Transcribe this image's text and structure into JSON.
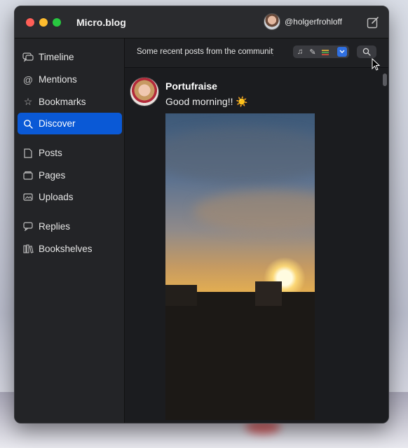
{
  "app": {
    "title": "Micro.blog"
  },
  "account": {
    "username": "@holgerfrohloff"
  },
  "sidebar": {
    "items": [
      {
        "label": "Timeline",
        "icon": "speech-bubbles-icon",
        "active": false
      },
      {
        "label": "Mentions",
        "icon": "at-sign-icon",
        "active": false
      },
      {
        "label": "Bookmarks",
        "icon": "star-icon",
        "active": false
      },
      {
        "label": "Discover",
        "icon": "search-icon",
        "active": true
      },
      {
        "label": "Posts",
        "icon": "document-icon",
        "active": false
      },
      {
        "label": "Pages",
        "icon": "folder-icon",
        "active": false
      },
      {
        "label": "Uploads",
        "icon": "photo-icon",
        "active": false
      },
      {
        "label": "Replies",
        "icon": "speech-bubble-icon",
        "active": false
      },
      {
        "label": "Bookshelves",
        "icon": "books-icon",
        "active": false
      }
    ]
  },
  "toolbar": {
    "description": "Some recent posts from the community",
    "segment_icons": [
      "music-note-icon",
      "pencil-icon",
      "books-icon"
    ],
    "accent": "#0a59d6"
  },
  "post": {
    "author": "Portufraise",
    "text": "Good morning!! ☀️"
  },
  "colors": {
    "accent": "#0a59d6",
    "window_bg": "#1e1f22",
    "sidebar_bg": "#232427"
  }
}
